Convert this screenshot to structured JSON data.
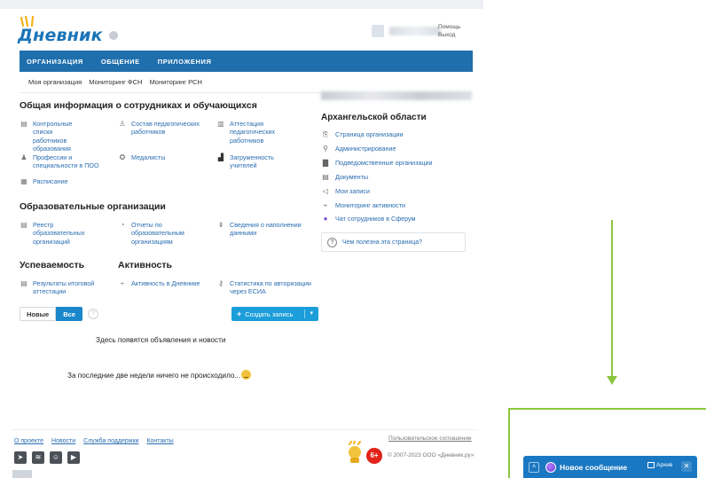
{
  "header": {
    "logo_text": "Дневник",
    "help_label": "Помощь",
    "logout_label": "Выход"
  },
  "nav": {
    "items": [
      "ОРГАНИЗАЦИЯ",
      "ОБЩЕНИЕ",
      "ПРИЛОЖЕНИЯ"
    ],
    "subitems": [
      "Моя организация",
      "Мониторинг ФСН",
      "Мониторинг РСН"
    ]
  },
  "sections": {
    "general": {
      "title": "Общая информация о сотрудниках и обучающихся",
      "items": [
        {
          "label": "Контрольные списки работников образования",
          "icon": "checklist-icon"
        },
        {
          "label": "Состав педагогических работников",
          "icon": "person-icon"
        },
        {
          "label": "Аттестация педагогических работников",
          "icon": "certificate-icon"
        },
        {
          "label": "Профессии и специальности в ПОО",
          "icon": "profession-icon"
        },
        {
          "label": "Медалисты",
          "icon": "medal-icon"
        },
        {
          "label": "Загруженность учителей",
          "icon": "bar-chart-icon"
        },
        {
          "label": "Расписание",
          "icon": "schedule-icon"
        }
      ]
    },
    "edu_orgs": {
      "title": "Образовательные организации",
      "items": [
        {
          "label": "Реестр образовательных организаций",
          "icon": "registry-icon"
        },
        {
          "label": "Отчеты по образовательным организациям",
          "icon": "report-icon"
        },
        {
          "label": "Сведения о наполнении данными",
          "icon": "data-fill-icon"
        }
      ]
    },
    "progress": {
      "title": "Успеваемость",
      "items": [
        {
          "label": "Результаты итоговой аттестации",
          "icon": "results-icon"
        }
      ]
    },
    "activity": {
      "title": "Активность",
      "items": [
        {
          "label": "Активность в Дневнике",
          "icon": "activity-icon"
        },
        {
          "label": "Статистика по авторизации через ЕСИА",
          "icon": "key-icon"
        }
      ]
    }
  },
  "right": {
    "title": "Архангельской области",
    "links": [
      {
        "label": "Страница организации",
        "icon": "page-icon"
      },
      {
        "label": "Администрирование",
        "icon": "wrench-icon"
      },
      {
        "label": "Подведомственные организации",
        "icon": "building-icon"
      },
      {
        "label": "Документы",
        "icon": "documents-icon"
      },
      {
        "label": "Мои записи",
        "icon": "megaphone-icon"
      },
      {
        "label": "Мониторинг активности",
        "icon": "pulse-icon"
      },
      {
        "label": "Чат сотрудников в Сферум",
        "icon": "sferum-icon"
      }
    ],
    "feedback": "Чем полезна эта страница?"
  },
  "news": {
    "tab_new": "Новые",
    "tab_all": "Все",
    "create_label": "Создать запись",
    "empty_text": "Здесь появятся объявления и новости",
    "nothing_text": "За последние две недели ничего не происходило..."
  },
  "footer": {
    "links": [
      "О проекте",
      "Новости",
      "Служба поддержки",
      "Контакты"
    ],
    "agreement": "Пользовательское соглашение",
    "copyright": "© 2007-2023 ООО «Дневник.ру»",
    "age": "6+"
  },
  "chat": {
    "title": "Новое сообщение",
    "archive": "Архив"
  },
  "colors": {
    "nav": "#1f6fad",
    "link": "#2a6db0",
    "create": "#1b9ed9",
    "annotation": "#8cc63f",
    "chat": "#1a78c2"
  }
}
